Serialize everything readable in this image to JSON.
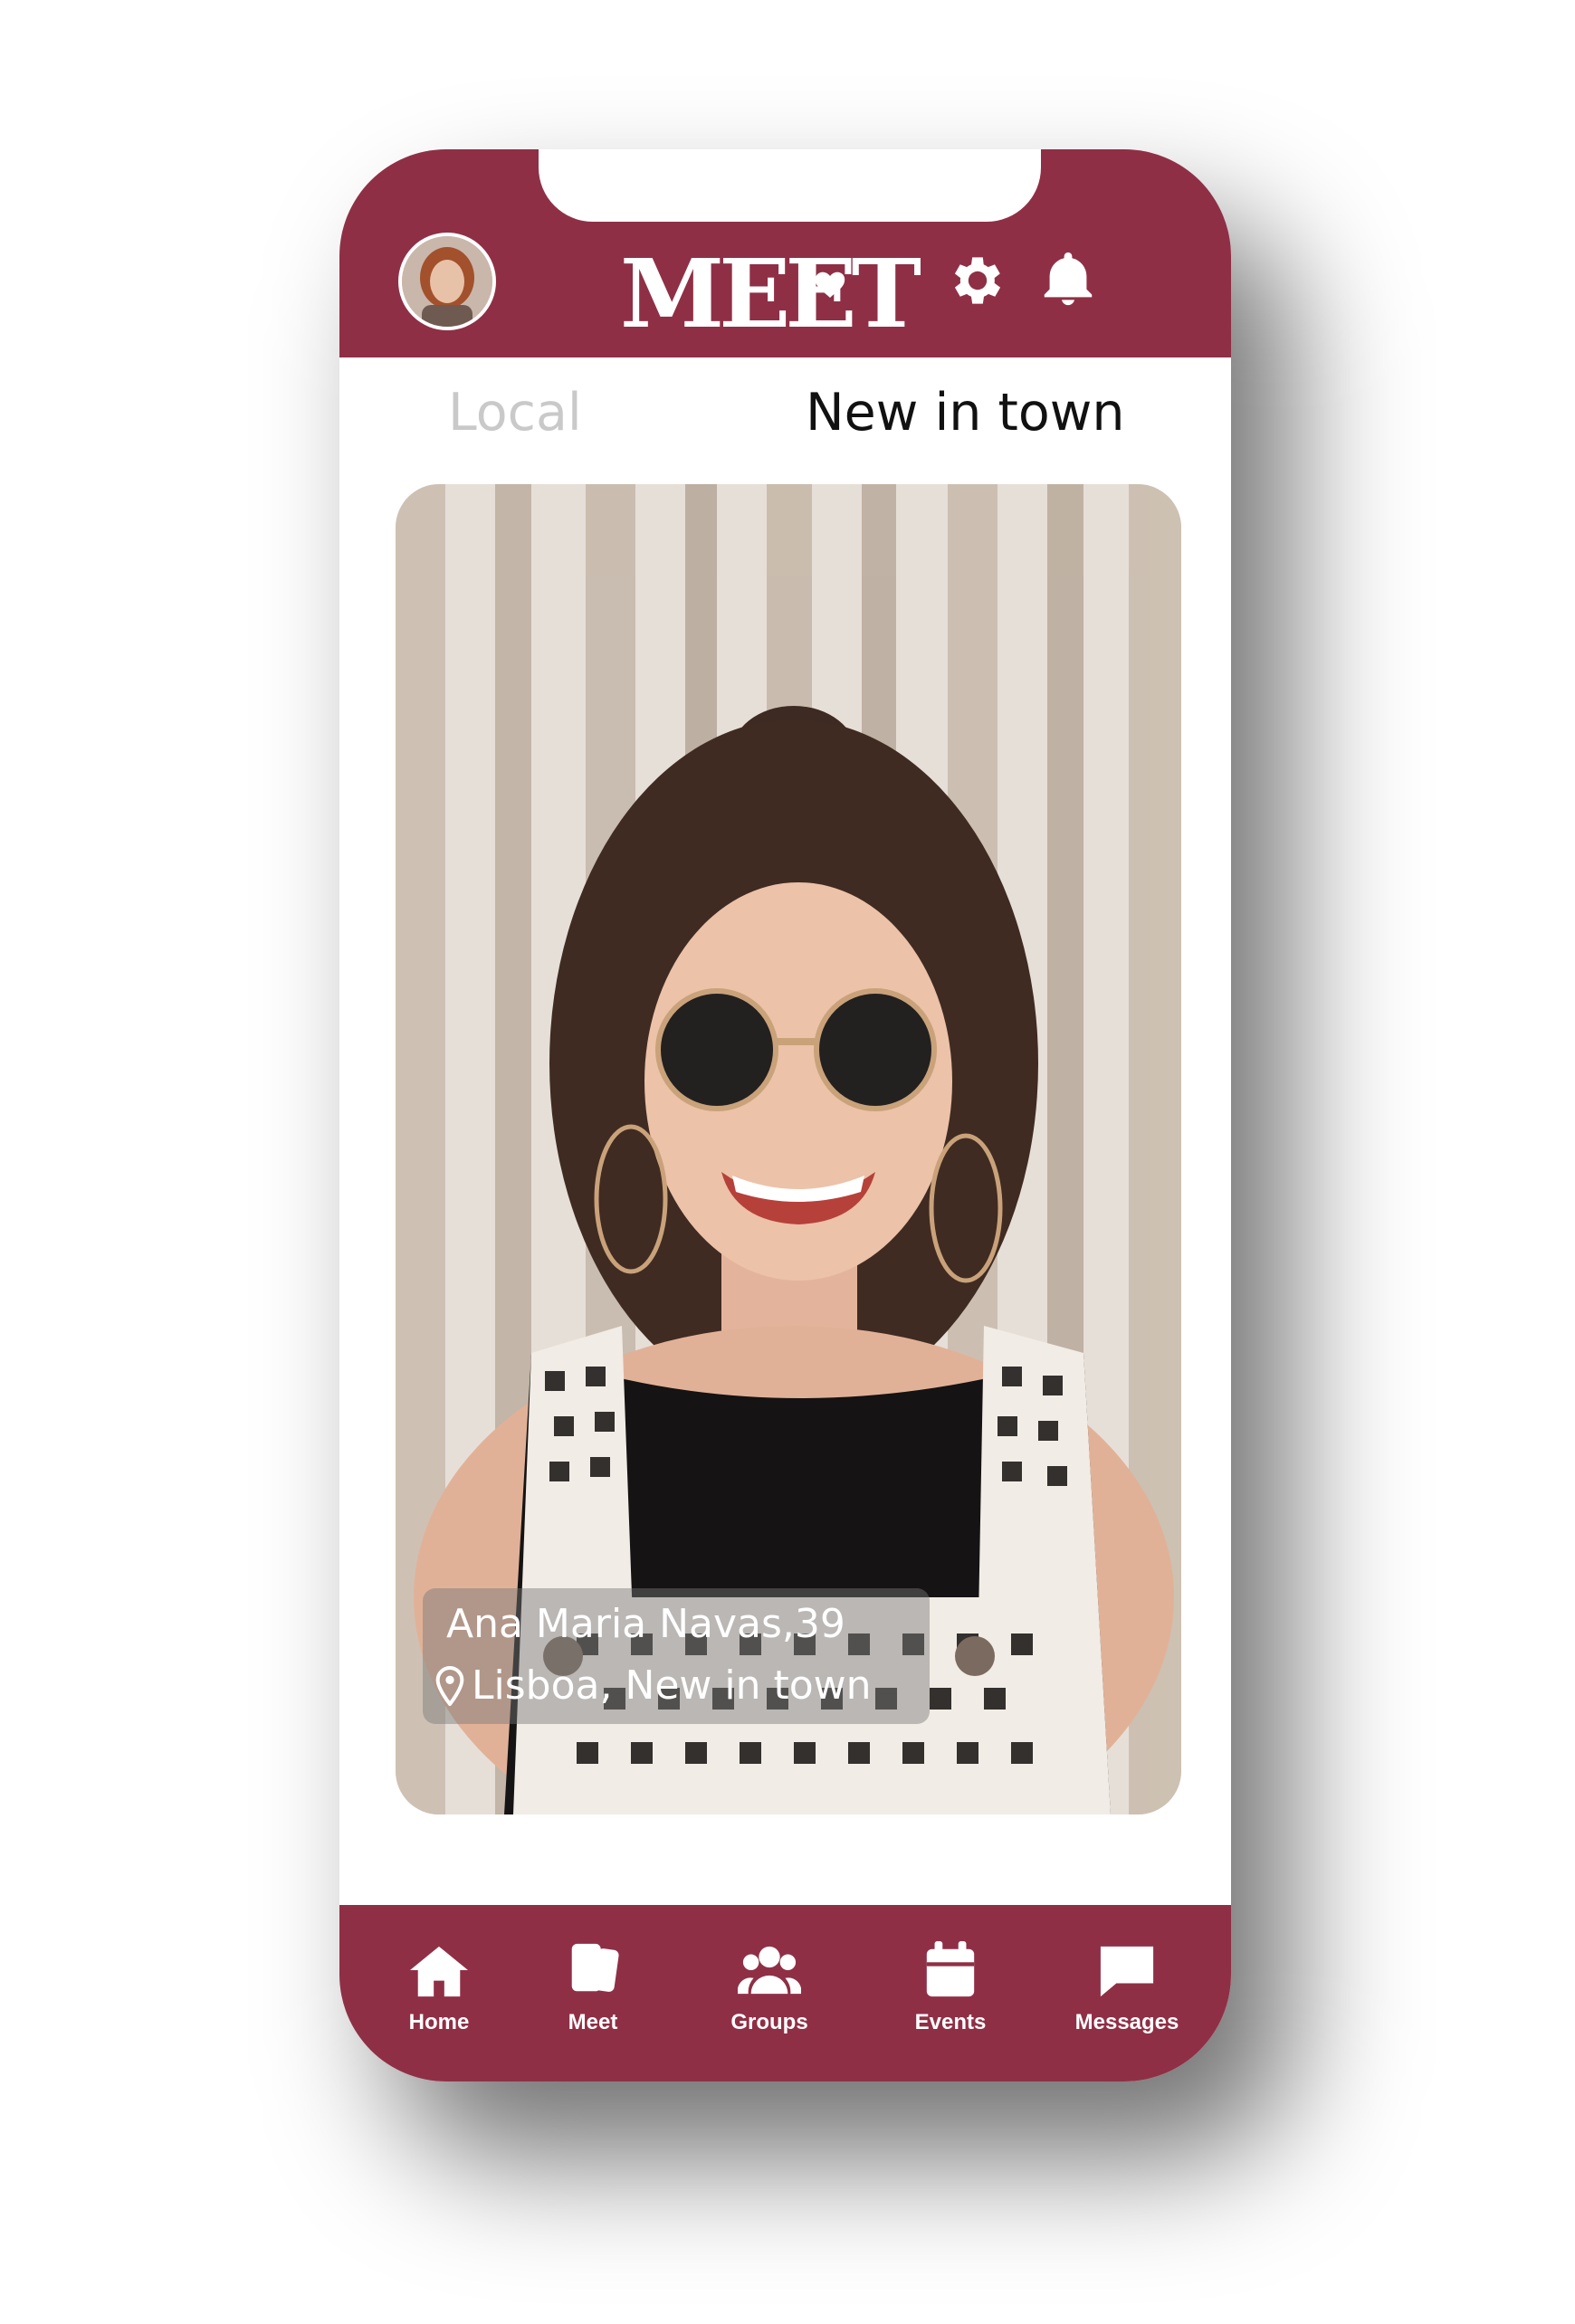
{
  "app": {
    "logo_text": "MEET"
  },
  "header": {
    "avatar": "user-avatar",
    "icons": [
      "gear-icon",
      "bell-icon"
    ]
  },
  "tabs": [
    {
      "label": "Local",
      "active": false
    },
    {
      "label": "New in town",
      "active": true
    }
  ],
  "profile_card": {
    "name_age": "Ana Maria Navas,39",
    "location": "Lisboa, New in town",
    "location_icon": "map-pin-icon"
  },
  "bottom_nav": [
    {
      "label": "Home",
      "icon": "home-icon"
    },
    {
      "label": "Meet",
      "icon": "cards-icon"
    },
    {
      "label": "Groups",
      "icon": "people-icon"
    },
    {
      "label": "Events",
      "icon": "calendar-icon"
    },
    {
      "label": "Messages",
      "icon": "chat-icon"
    }
  ],
  "colors": {
    "brand": "#8f2f45",
    "inactive_tab": "#c9c9c9",
    "active_tab": "#111111",
    "background": "#ffffff"
  }
}
